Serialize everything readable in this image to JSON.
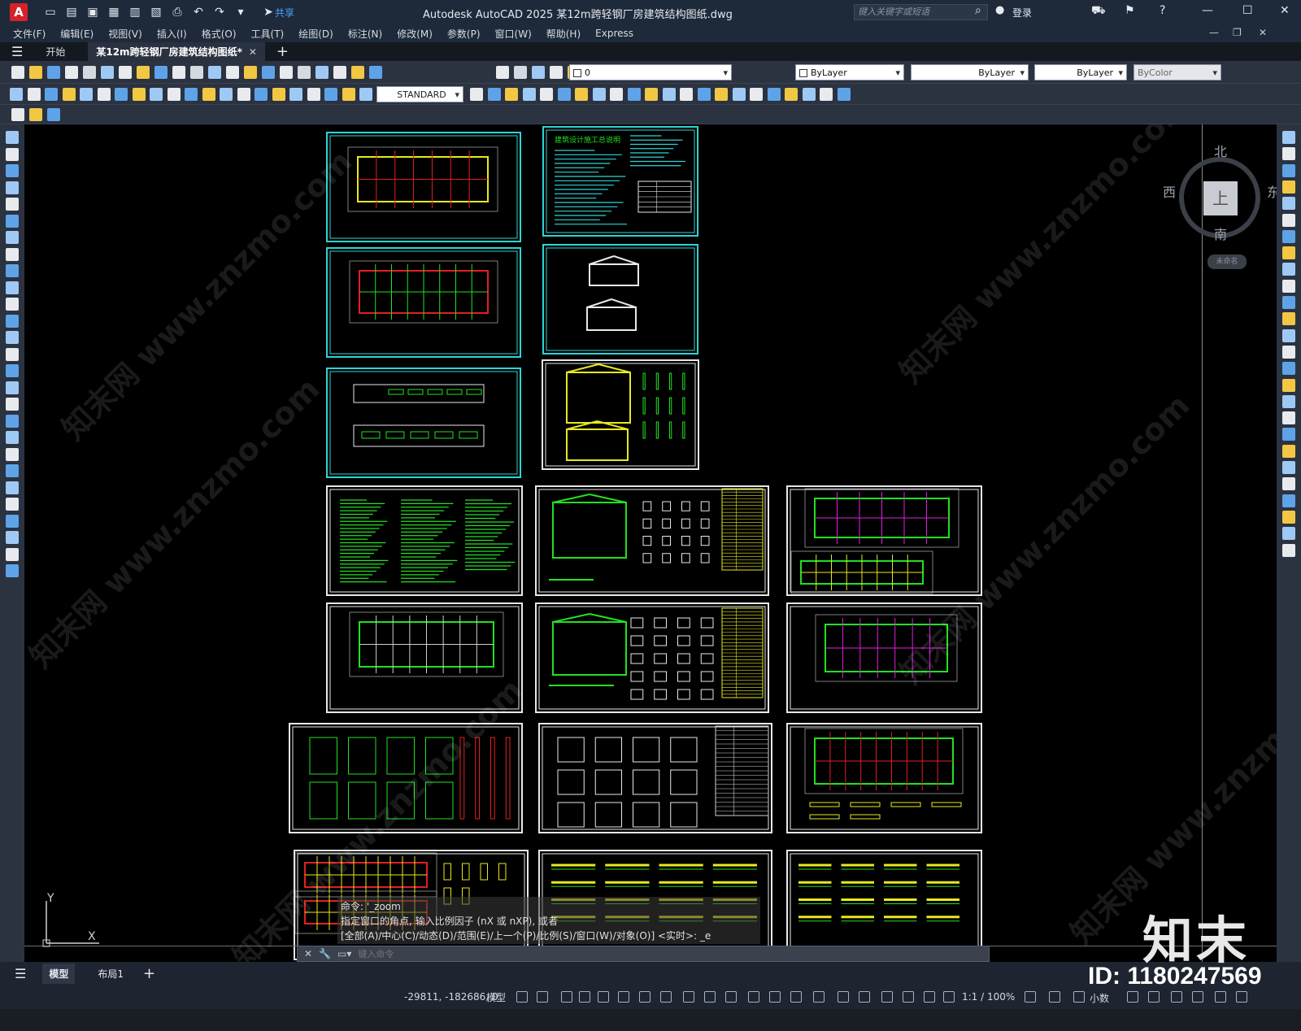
{
  "app": {
    "logo_letter": "A",
    "title": "Autodesk AutoCAD 2025    某12m跨轻钢厂房建筑结构图纸.dwg",
    "share_label": "共享",
    "search_placeholder": "键入关键字或短语",
    "login_label": "登录"
  },
  "menu": [
    "文件(F)",
    "编辑(E)",
    "视图(V)",
    "插入(I)",
    "格式(O)",
    "工具(T)",
    "绘图(D)",
    "标注(N)",
    "修改(M)",
    "参数(P)",
    "窗口(W)",
    "帮助(H)",
    "Express"
  ],
  "tabs": {
    "start": "开始",
    "file": "某12m跨轻钢厂房建筑结构图纸*"
  },
  "toolbar": {
    "layer_value": "0",
    "color_value": "ByLayer",
    "linetype_value": "ByLayer",
    "lineweight_value": "ByLayer",
    "plotstyle_value": "ByColor",
    "textstyle_value": "STANDARD"
  },
  "viewcube": {
    "north": "北",
    "south": "南",
    "west": "西",
    "east": "东",
    "top_face": "上",
    "wcs_label": "未命名"
  },
  "ucs": {
    "x_label": "X",
    "y_label": "Y"
  },
  "command": {
    "history": [
      "命令:  '_zoom",
      "指定窗口的角点, 输入比例因子 (nX 或 nXP), 或者",
      "[全部(A)/中心(C)/动态(D)/范围(E)/上一个(P)/比例(S)/窗口(W)/对象(O)] <实时>: _e"
    ],
    "placeholder": "键入命令"
  },
  "layout_tabs": [
    "模型",
    "布局1"
  ],
  "status": {
    "coords": "-29811, -182686, 0",
    "model_label": "模型",
    "scale": "1:1 / 100%",
    "units": "小数"
  },
  "sheet1_title": "建筑设计施工总说明",
  "watermark": {
    "logo": "知末",
    "id": "ID: 1180247569",
    "site": "知末网 www.znzmo.com"
  },
  "colors": {
    "frame_cyan": "#2fd4d4",
    "frame_white": "#e8e8e8",
    "canvas": "#000000",
    "line_green": "#22e022",
    "line_yellow": "#e8e820",
    "line_red": "#e02020",
    "line_magenta": "#e020e0"
  }
}
